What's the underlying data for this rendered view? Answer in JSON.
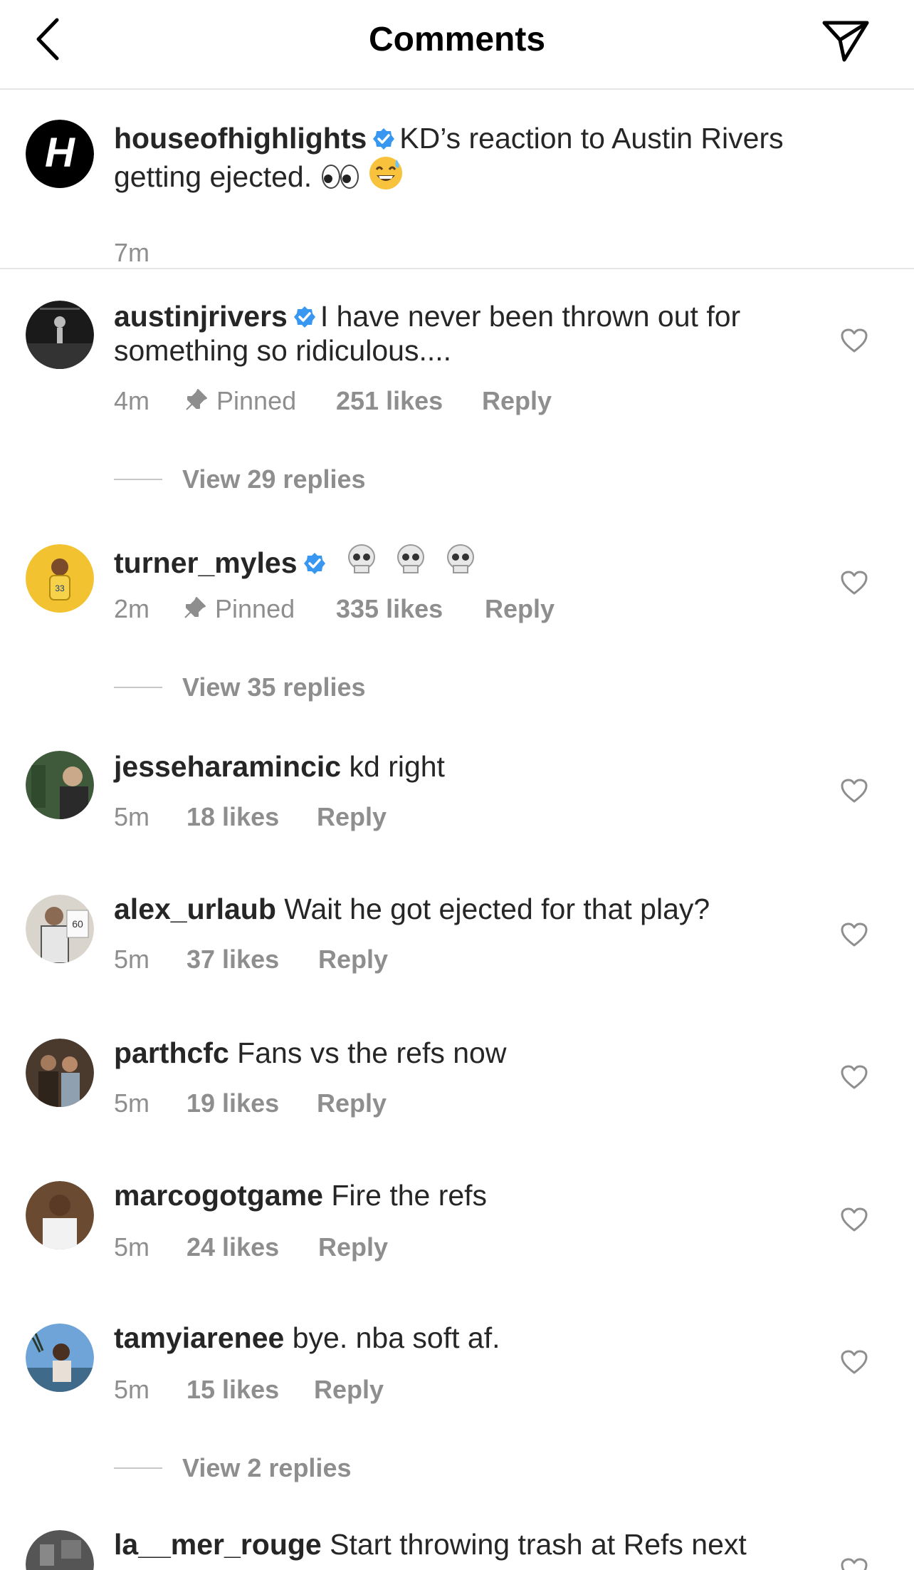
{
  "header": {
    "title": "Comments"
  },
  "caption": {
    "username": "houseofhighlights",
    "text": "KD’s reaction to Austin Rivers getting ejected.",
    "time": "7m"
  },
  "comments": [
    {
      "username": "austinjrivers",
      "verified": true,
      "text": "I have never been thrown out for something so ridiculous....",
      "time": "4m",
      "pinned": "Pinned",
      "likes": "251 likes",
      "reply": "Reply",
      "view_replies": "View 29 replies"
    },
    {
      "username": "turner_myles",
      "verified": true,
      "text": "",
      "time": "2m",
      "pinned": "Pinned",
      "likes": "335 likes",
      "reply": "Reply",
      "view_replies": "View 35 replies"
    },
    {
      "username": "jesseharamincic",
      "text": "kd right",
      "time": "5m",
      "likes": "18 likes",
      "reply": "Reply"
    },
    {
      "username": "alex_urlaub",
      "text": "Wait he got ejected for that play?",
      "time": "5m",
      "likes": "37 likes",
      "reply": "Reply"
    },
    {
      "username": "parthcfc",
      "text": "Fans vs the refs now",
      "time": "5m",
      "likes": "19 likes",
      "reply": "Reply"
    },
    {
      "username": "marcogotgame",
      "text": "Fire the refs",
      "time": "5m",
      "likes": "24 likes",
      "reply": "Reply"
    },
    {
      "username": "tamyiarenee",
      "text": "bye. nba soft af.",
      "time": "5m",
      "likes": "15 likes",
      "reply": "Reply",
      "view_replies": "View 2 replies"
    },
    {
      "username": "la__mer_rouge",
      "text": "Start throwing trash at Refs next",
      "time": "",
      "likes": "",
      "reply": ""
    }
  ],
  "colors": {
    "text": "#262626",
    "muted": "#8e8e8e",
    "verified": "#3897f0",
    "divider": "#e6e6e6"
  },
  "icons": {
    "back": "chevron-left-icon",
    "send": "paper-plane-icon",
    "pin": "pin-icon",
    "like": "heart-icon",
    "verified": "verified-badge-icon"
  }
}
